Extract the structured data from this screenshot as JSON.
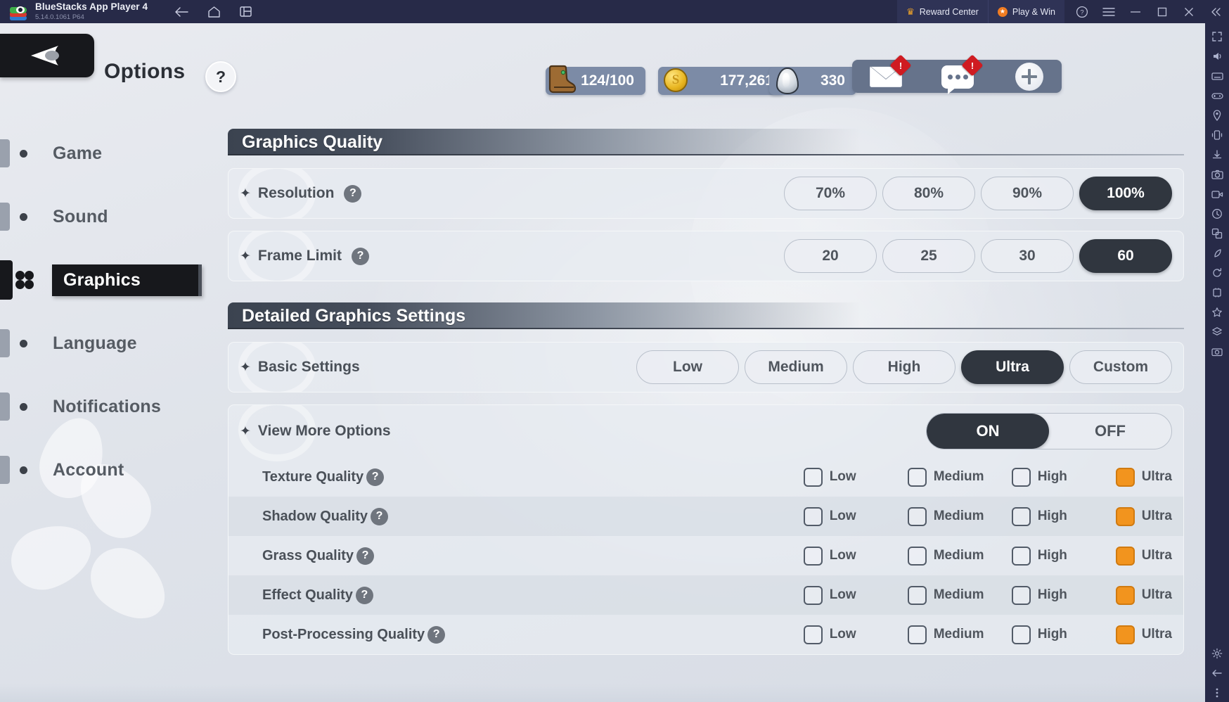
{
  "titlebar": {
    "app_name": "BlueStacks App Player 4",
    "version": "5.14.0.1061  P64",
    "nav_icons": [
      "back-icon",
      "home-icon",
      "multi-instance-icon"
    ],
    "reward_center": "Reward Center",
    "play_and_win": "Play & Win",
    "sys_icons": [
      "help-icon",
      "menu-icon",
      "minimize-icon",
      "maximize-icon",
      "close-icon",
      "collapse-icon"
    ]
  },
  "game_header": {
    "back_label": "back-arrow",
    "page_title": "Options",
    "help_label": "?",
    "currencies": [
      {
        "icon": "boot-icon",
        "value": "124/100"
      },
      {
        "icon": "coin-icon",
        "value": "177,261"
      },
      {
        "icon": "gem-icon",
        "value": "330"
      }
    ],
    "social": [
      {
        "icon": "mail-icon",
        "badge": "!"
      },
      {
        "icon": "chat-icon",
        "badge": "!"
      },
      {
        "icon": "add-friend-icon",
        "badge": ""
      }
    ]
  },
  "sidebar": {
    "items": [
      {
        "label": "Game",
        "active": false
      },
      {
        "label": "Sound",
        "active": false
      },
      {
        "label": "Graphics",
        "active": true
      },
      {
        "label": "Language",
        "active": false
      },
      {
        "label": "Notifications",
        "active": false
      },
      {
        "label": "Account",
        "active": false
      }
    ]
  },
  "sections": [
    {
      "title": "Graphics Quality",
      "rows": [
        {
          "name": "Resolution",
          "help": "?",
          "options": [
            "70%",
            "80%",
            "90%",
            "100%"
          ],
          "selected": "100%"
        },
        {
          "name": "Frame Limit",
          "help": "?",
          "options": [
            "20",
            "25",
            "30",
            "60"
          ],
          "selected": "60"
        }
      ]
    },
    {
      "title": "Detailed Graphics Settings",
      "rows": [
        {
          "name": "Basic Settings",
          "help": "",
          "options": [
            "Low",
            "Medium",
            "High",
            "Ultra",
            "Custom"
          ],
          "selected": "Ultra"
        }
      ],
      "toggle_row": {
        "name": "View More Options",
        "on_label": "ON",
        "off_label": "OFF",
        "state": "ON"
      },
      "detail_rows": [
        {
          "name": "Texture Quality",
          "help": "?",
          "options": [
            "Low",
            "Medium",
            "High",
            "Ultra"
          ],
          "checked": "Ultra"
        },
        {
          "name": "Shadow Quality",
          "help": "?",
          "options": [
            "Low",
            "Medium",
            "High",
            "Ultra"
          ],
          "checked": "Ultra"
        },
        {
          "name": "Grass Quality",
          "help": "?",
          "options": [
            "Low",
            "Medium",
            "High",
            "Ultra"
          ],
          "checked": "Ultra"
        },
        {
          "name": "Effect Quality",
          "help": "?",
          "options": [
            "Low",
            "Medium",
            "High",
            "Ultra"
          ],
          "checked": "Ultra"
        },
        {
          "name": "Post-Processing Quality",
          "help": "?",
          "options": [
            "Low",
            "Medium",
            "High",
            "Ultra"
          ],
          "checked": "Ultra"
        }
      ]
    }
  ],
  "colors": {
    "titlebar_bg": "#272a48",
    "selected_pill": "#30363f",
    "checkbox_on": "#f2941e",
    "badge_red": "#cf1b21",
    "accent_orange": "#f07c22"
  }
}
